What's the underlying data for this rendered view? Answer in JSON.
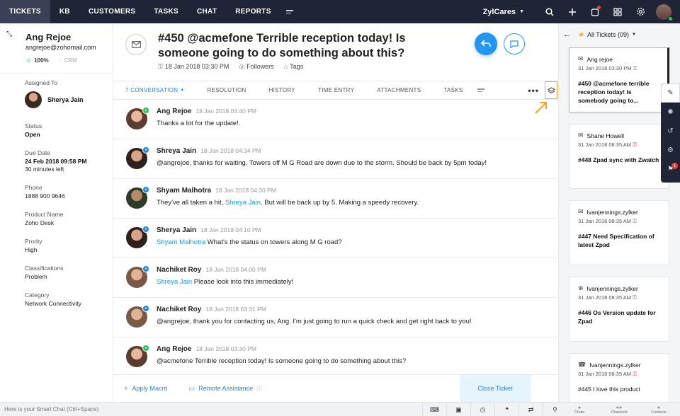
{
  "nav": {
    "items": [
      "TICKETS",
      "KB",
      "CUSTOMERS",
      "TASKS",
      "CHAT",
      "REPORTS"
    ],
    "active": "TICKETS",
    "brand": "ZylCares"
  },
  "contact": {
    "name": "Ang Rejoe",
    "email": "angrejoe@zohomail.com",
    "happiness": "100%",
    "crm": "CRM"
  },
  "fields": {
    "assigned_label": "Assigned To",
    "assigned_value": "Sherya Jain",
    "status_label": "Status",
    "status_value": "Open",
    "due_label": "Due Date",
    "due_value": "24 Feb 2018 09:58 PM",
    "due_sub": "30 minutes left",
    "phone_label": "Phone",
    "phone_value": "1888 900 9646",
    "product_label": "Product Name",
    "product_value": "Zoho Desk",
    "priority_label": "Prority",
    "priority_value": "High",
    "class_label": "Classifications",
    "class_value": "Problem",
    "category_label": "Category",
    "category_value": "Network Connectivity"
  },
  "ticket": {
    "title": "#450 @acmefone Terrible reception today! Is someone going to do something about this?",
    "date": "18 Jan 2018 03:30 PM",
    "followers": "Followers",
    "tags": "Tags"
  },
  "tabs": {
    "conversation": "7 CONVERSATION",
    "resolution": "RESOLUTION",
    "history": "HISTORY",
    "time_entry": "TIME ENTRY",
    "attachments": "ATTACHMENTS",
    "tasks": "TASKS",
    "more": "•••"
  },
  "messages": [
    {
      "name": "Ang Rejoe",
      "time": "18 Jan 2018 04:40 PM",
      "mention": "",
      "text": "Thanks a lot for the update!.",
      "badge_color": "#22c55e"
    },
    {
      "name": "Shreya Jain",
      "time": "18 Jan 2018 04:34 PM",
      "mention": "",
      "text": "@angrejoe, thanks for waiting. Towers off M G Road are down due to the storm. Should be back by 5pm today!",
      "badge_color": "#1e88e5"
    },
    {
      "name": "Shyam Malhotra",
      "time": "18 Jan 2018 04:30 PM",
      "mention": "Shreya Jain",
      "text_pre": "They've all taken a hit, ",
      "text": ". But will be back up by 5. Making a speedy recovery.",
      "badge_color": "#1e88e5"
    },
    {
      "name": "Sherya Jain",
      "time": "18 Jan 2018 04:10 PM",
      "mention": "Shyam Malhotra",
      "text": " What's the status on towers along M G road?",
      "badge_color": "#1e88e5"
    },
    {
      "name": "Nachiket Roy",
      "time": "18 Jan 2018 04:00 PM",
      "mention": "Shreya Jain",
      "text": " Please look into this immediately!",
      "badge_color": "#1e88e5"
    },
    {
      "name": "Nachiket Roy",
      "time": "18 Jan 2018 03:31 PM",
      "mention": "",
      "text": "@angrejoe, thank you for contacting us, Ang. I'm just going to run a quick check and get right back to you!",
      "badge_color": "#1e88e5"
    },
    {
      "name": "Ang Rejoe",
      "time": "18 Jan 2018 03:30 PM",
      "mention": "",
      "text": "@acmefone Terrible reception today! Is someone going to do something about this?",
      "badge_color": "#22c55e"
    }
  ],
  "footer": {
    "apply_macro": "Apply Macro",
    "remote_assistance": "Remote Assistance",
    "close_ticket": "Close Ticket"
  },
  "tickets_list": {
    "header": "All Tickets (09)",
    "cards": [
      {
        "from": "Ang rejoe",
        "date": "31 Jan 2018 03:30 PM",
        "subject": "#450 @acmefone terrible reception today! Is somebody going to...",
        "icon": "mail-icon"
      },
      {
        "from": "Shane Howell",
        "date": "31 Jan 2018 08:35 AM",
        "subject": "#448 Zpad sync with Zwatch",
        "icon": "mail-icon"
      },
      {
        "from": "Ivanjennings.zylker",
        "date": "31 Jan 2018 08:35 AM",
        "subject": "#447 Need Specification of latest Zpad",
        "icon": "mail-icon"
      },
      {
        "from": "Ivanjennings.zylker",
        "date": "31 Jan 2018 08:35 AM",
        "subject": "#446 Os Version update for Zpad",
        "icon": "globe-icon"
      },
      {
        "from": "Ivanjennings.zylker",
        "date": "31 Jan 2018 08:35 AM",
        "subject": "#445 I love this product",
        "icon": "phone-icon"
      }
    ]
  },
  "side_tools": {
    "notif_count": "1"
  },
  "bottom": {
    "smart_chat": "Here is your Smart Chat (Ctrl+Space)",
    "chats": "Chats",
    "channels": "Channels",
    "contacts": "Contacts"
  },
  "colors": {
    "nav_bg": "#1f2436",
    "accent": "#1e88e5",
    "highlight": "#f5a623"
  }
}
